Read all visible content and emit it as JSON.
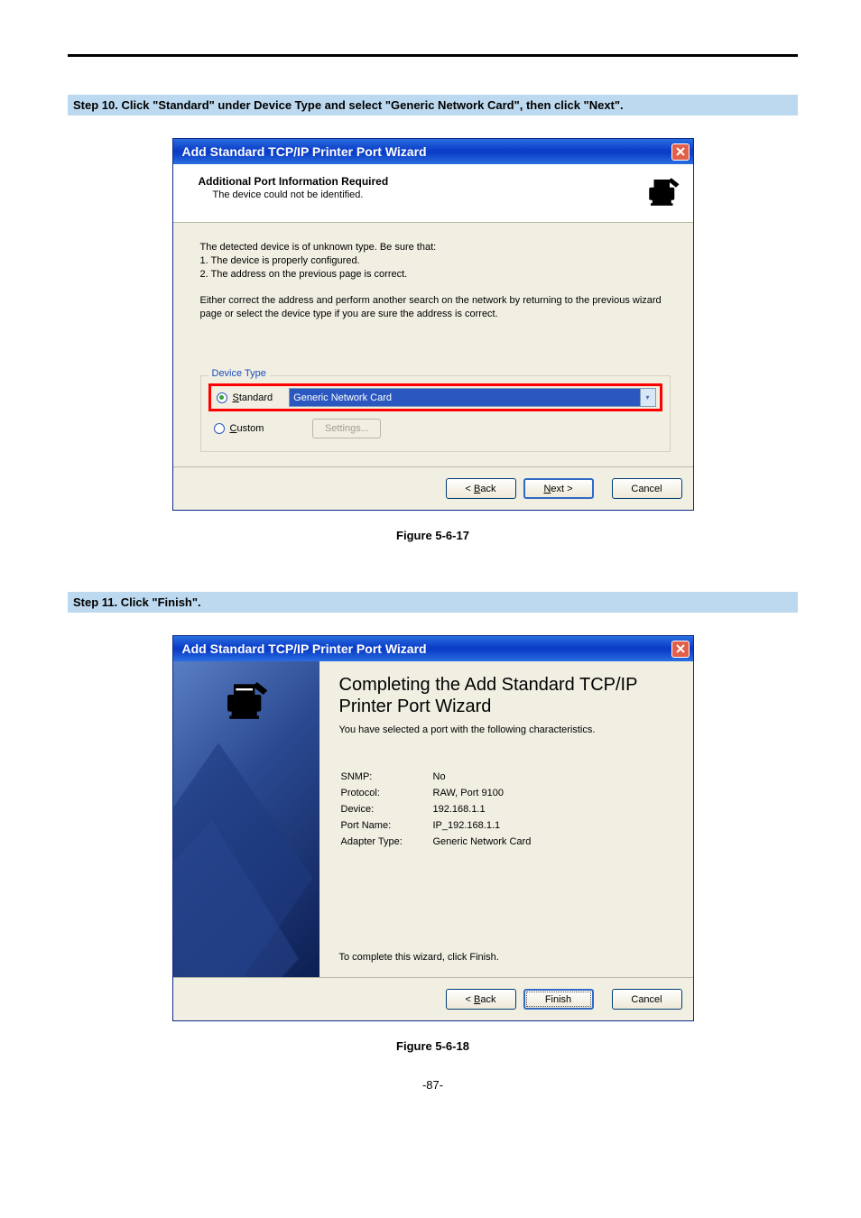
{
  "step10": {
    "heading": "Step 10.  Click \"Standard\" under Device Type and select \"Generic Network Card\", then click \"Next\".",
    "figure": "Figure 5-6-17"
  },
  "dialog1": {
    "title": "Add Standard TCP/IP Printer Port Wizard",
    "header_title": "Additional Port Information Required",
    "header_sub": "The device could not be identified.",
    "body_line1": "The detected device is of unknown type.  Be sure that:",
    "body_line2": "1. The device is properly configured.",
    "body_line3": "2.  The address on the previous page is correct.",
    "body_para2": "Either correct the address and perform another search on the network by returning to the previous wizard page or select the device type if you are sure the address is correct.",
    "fieldset": "Device Type",
    "standard_label_pre": "S",
    "standard_label_rest": "tandard",
    "custom_label_pre": "C",
    "custom_label_rest": "ustom",
    "combo_value": "Generic Network Card",
    "settings_btn": "Settings...",
    "back_pre": "< ",
    "back_u": "B",
    "back_rest": "ack",
    "next_u": "N",
    "next_rest": "ext >",
    "cancel": "Cancel"
  },
  "step11": {
    "heading": "Step 11.  Click \"Finish\".",
    "figure": "Figure 5-6-18"
  },
  "dialog2": {
    "title": "Add Standard TCP/IP Printer Port Wizard",
    "main_title": "Completing the Add Standard TCP/IP Printer Port Wizard",
    "sub": "You have selected a port with the following characteristics.",
    "rows": [
      {
        "k": "SNMP:",
        "v": "No"
      },
      {
        "k": "Protocol:",
        "v": "RAW, Port 9100"
      },
      {
        "k": "Device:",
        "v": "192.168.1.1"
      },
      {
        "k": "Port Name:",
        "v": "IP_192.168.1.1"
      },
      {
        "k": "Adapter Type:",
        "v": "Generic Network Card"
      }
    ],
    "complete": "To complete this wizard, click Finish.",
    "back_pre": "< ",
    "back_u": "B",
    "back_rest": "ack",
    "finish": "Finish",
    "cancel": "Cancel"
  },
  "page_number": "-87-"
}
